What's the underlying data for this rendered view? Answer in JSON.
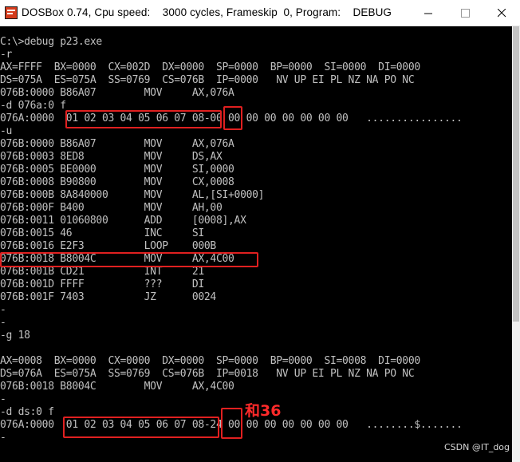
{
  "window": {
    "title": "DOSBox 0.74, Cpu speed:    3000 cycles, Frameskip  0, Program:    DEBUG"
  },
  "console": {
    "lines": [
      "C:\\>debug p23.exe",
      "-r",
      "AX=FFFF  BX=0000  CX=002D  DX=0000  SP=0000  BP=0000  SI=0000  DI=0000",
      "DS=075A  ES=075A  SS=0769  CS=076B  IP=0000   NV UP EI PL NZ NA PO NC",
      "076B:0000 B86A07        MOV     AX,076A",
      "-d 076a:0 f",
      "076A:0000  01 02 03 04 05 06 07 08-00 00 00 00 00 00 00 00   ................",
      "-u",
      "076B:0000 B86A07        MOV     AX,076A",
      "076B:0003 8ED8          MOV     DS,AX",
      "076B:0005 BE0000        MOV     SI,0000",
      "076B:0008 B90800        MOV     CX,0008",
      "076B:000B 8A840000      MOV     AL,[SI+0000]",
      "076B:000F B400          MOV     AH,00",
      "076B:0011 01060800      ADD     [0008],AX",
      "076B:0015 46            INC     SI",
      "076B:0016 E2F3          LOOP    000B",
      "076B:0018 B8004C        MOV     AX,4C00",
      "076B:001B CD21          INT     21",
      "076B:001D FFFF          ???     DI",
      "076B:001F 7403          JZ      0024",
      "-",
      "-",
      "-g 18",
      "",
      "AX=0008  BX=0000  CX=0000  DX=0000  SP=0000  BP=0000  SI=0008  DI=0000",
      "DS=076A  ES=075A  SS=0769  CS=076B  IP=0018   NV UP EI PL NZ NA PO NC",
      "076B:0018 B8004C        MOV     AX,4C00",
      "-",
      "-d ds:0 f",
      "076A:0000  01 02 03 04 05 06 07 08-24 00 00 00 00 00 00 00   ........$.......",
      "-"
    ]
  },
  "annotation": {
    "note": "和36",
    "color": "#e02020"
  },
  "watermark": "CSDN @IT_dog",
  "icons": {
    "app": "dosbox-icon",
    "minimize": "minimize-icon",
    "maximize": "maximize-icon",
    "close": "close-icon"
  }
}
